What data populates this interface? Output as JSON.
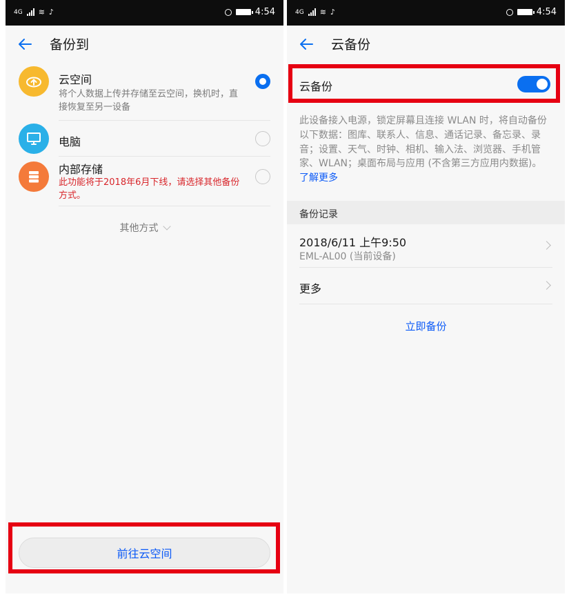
{
  "left": {
    "status": {
      "network": "4G",
      "time": "4:54"
    },
    "header": {
      "title": "备份到"
    },
    "options": [
      {
        "title": "云空间",
        "desc": "将个人数据上传并存储至云空间，换机时，直接恢复至另一设备",
        "selected": true,
        "icon": "cloud-icon",
        "color": "#f7b92f"
      },
      {
        "title": "电脑",
        "desc": "",
        "selected": false,
        "icon": "monitor-icon",
        "color": "#2ab0e8"
      },
      {
        "title": "内部存储",
        "desc": "此功能将于2018年6月下线，请选择其他备份方式。",
        "selected": false,
        "icon": "storage-icon",
        "color": "#f47a3a"
      }
    ],
    "other_ways": "其他方式",
    "go_button": "前往云空间"
  },
  "right": {
    "status": {
      "network": "4G",
      "time": "4:54"
    },
    "header": {
      "title": "云备份"
    },
    "toggle": {
      "label": "云备份",
      "on": true
    },
    "description": "此设备接入电源，锁定屏幕且连接 WLAN 时，将自动备份以下数据：图库、联系人、信息、通话记录、备忘录、录音；设置、天气、时钟、相机、输入法、浏览器、手机管家、WLAN；桌面布局与应用 (不含第三方应用内数据)。",
    "learn_more": "了解更多",
    "section_title": "备份记录",
    "records": [
      {
        "title": "2018/6/11 上午9:50",
        "subtitle": "EML-AL00 (当前设备)"
      },
      {
        "title": "更多",
        "subtitle": ""
      }
    ],
    "backup_now": "立即备份"
  },
  "colors": {
    "accent": "#0a6ff0",
    "link": "#0a59f7",
    "warning": "#d8262b",
    "highlight": "#e60012"
  }
}
